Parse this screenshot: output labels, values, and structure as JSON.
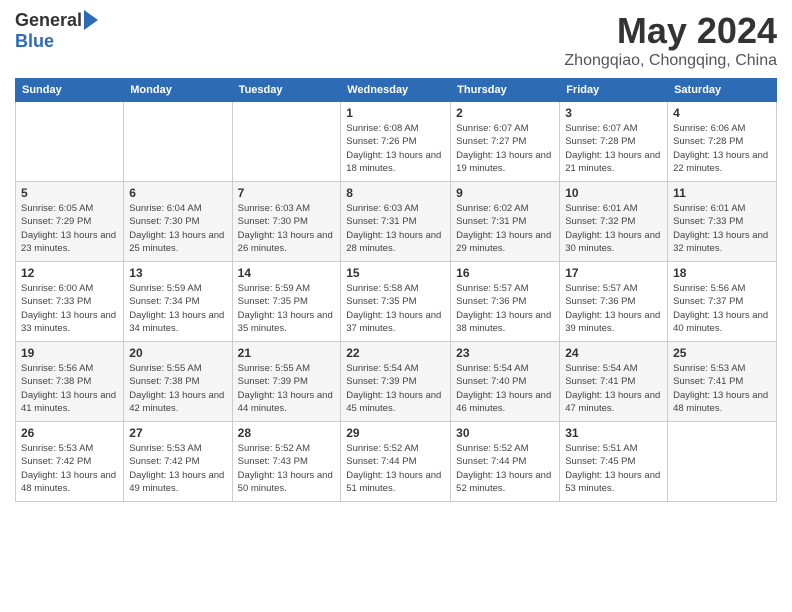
{
  "header": {
    "logo": {
      "general": "General",
      "blue": "Blue"
    },
    "title": "May 2024",
    "location": "Zhongqiao, Chongqing, China"
  },
  "calendar": {
    "days_of_week": [
      "Sunday",
      "Monday",
      "Tuesday",
      "Wednesday",
      "Thursday",
      "Friday",
      "Saturday"
    ],
    "weeks": [
      [
        {
          "day": "",
          "info": ""
        },
        {
          "day": "",
          "info": ""
        },
        {
          "day": "",
          "info": ""
        },
        {
          "day": "1",
          "info": "Sunrise: 6:08 AM\nSunset: 7:26 PM\nDaylight: 13 hours and 18 minutes."
        },
        {
          "day": "2",
          "info": "Sunrise: 6:07 AM\nSunset: 7:27 PM\nDaylight: 13 hours and 19 minutes."
        },
        {
          "day": "3",
          "info": "Sunrise: 6:07 AM\nSunset: 7:28 PM\nDaylight: 13 hours and 21 minutes."
        },
        {
          "day": "4",
          "info": "Sunrise: 6:06 AM\nSunset: 7:28 PM\nDaylight: 13 hours and 22 minutes."
        }
      ],
      [
        {
          "day": "5",
          "info": "Sunrise: 6:05 AM\nSunset: 7:29 PM\nDaylight: 13 hours and 23 minutes."
        },
        {
          "day": "6",
          "info": "Sunrise: 6:04 AM\nSunset: 7:30 PM\nDaylight: 13 hours and 25 minutes."
        },
        {
          "day": "7",
          "info": "Sunrise: 6:03 AM\nSunset: 7:30 PM\nDaylight: 13 hours and 26 minutes."
        },
        {
          "day": "8",
          "info": "Sunrise: 6:03 AM\nSunset: 7:31 PM\nDaylight: 13 hours and 28 minutes."
        },
        {
          "day": "9",
          "info": "Sunrise: 6:02 AM\nSunset: 7:31 PM\nDaylight: 13 hours and 29 minutes."
        },
        {
          "day": "10",
          "info": "Sunrise: 6:01 AM\nSunset: 7:32 PM\nDaylight: 13 hours and 30 minutes."
        },
        {
          "day": "11",
          "info": "Sunrise: 6:01 AM\nSunset: 7:33 PM\nDaylight: 13 hours and 32 minutes."
        }
      ],
      [
        {
          "day": "12",
          "info": "Sunrise: 6:00 AM\nSunset: 7:33 PM\nDaylight: 13 hours and 33 minutes."
        },
        {
          "day": "13",
          "info": "Sunrise: 5:59 AM\nSunset: 7:34 PM\nDaylight: 13 hours and 34 minutes."
        },
        {
          "day": "14",
          "info": "Sunrise: 5:59 AM\nSunset: 7:35 PM\nDaylight: 13 hours and 35 minutes."
        },
        {
          "day": "15",
          "info": "Sunrise: 5:58 AM\nSunset: 7:35 PM\nDaylight: 13 hours and 37 minutes."
        },
        {
          "day": "16",
          "info": "Sunrise: 5:57 AM\nSunset: 7:36 PM\nDaylight: 13 hours and 38 minutes."
        },
        {
          "day": "17",
          "info": "Sunrise: 5:57 AM\nSunset: 7:36 PM\nDaylight: 13 hours and 39 minutes."
        },
        {
          "day": "18",
          "info": "Sunrise: 5:56 AM\nSunset: 7:37 PM\nDaylight: 13 hours and 40 minutes."
        }
      ],
      [
        {
          "day": "19",
          "info": "Sunrise: 5:56 AM\nSunset: 7:38 PM\nDaylight: 13 hours and 41 minutes."
        },
        {
          "day": "20",
          "info": "Sunrise: 5:55 AM\nSunset: 7:38 PM\nDaylight: 13 hours and 42 minutes."
        },
        {
          "day": "21",
          "info": "Sunrise: 5:55 AM\nSunset: 7:39 PM\nDaylight: 13 hours and 44 minutes."
        },
        {
          "day": "22",
          "info": "Sunrise: 5:54 AM\nSunset: 7:39 PM\nDaylight: 13 hours and 45 minutes."
        },
        {
          "day": "23",
          "info": "Sunrise: 5:54 AM\nSunset: 7:40 PM\nDaylight: 13 hours and 46 minutes."
        },
        {
          "day": "24",
          "info": "Sunrise: 5:54 AM\nSunset: 7:41 PM\nDaylight: 13 hours and 47 minutes."
        },
        {
          "day": "25",
          "info": "Sunrise: 5:53 AM\nSunset: 7:41 PM\nDaylight: 13 hours and 48 minutes."
        }
      ],
      [
        {
          "day": "26",
          "info": "Sunrise: 5:53 AM\nSunset: 7:42 PM\nDaylight: 13 hours and 48 minutes."
        },
        {
          "day": "27",
          "info": "Sunrise: 5:53 AM\nSunset: 7:42 PM\nDaylight: 13 hours and 49 minutes."
        },
        {
          "day": "28",
          "info": "Sunrise: 5:52 AM\nSunset: 7:43 PM\nDaylight: 13 hours and 50 minutes."
        },
        {
          "day": "29",
          "info": "Sunrise: 5:52 AM\nSunset: 7:44 PM\nDaylight: 13 hours and 51 minutes."
        },
        {
          "day": "30",
          "info": "Sunrise: 5:52 AM\nSunset: 7:44 PM\nDaylight: 13 hours and 52 minutes."
        },
        {
          "day": "31",
          "info": "Sunrise: 5:51 AM\nSunset: 7:45 PM\nDaylight: 13 hours and 53 minutes."
        },
        {
          "day": "",
          "info": ""
        }
      ]
    ]
  }
}
